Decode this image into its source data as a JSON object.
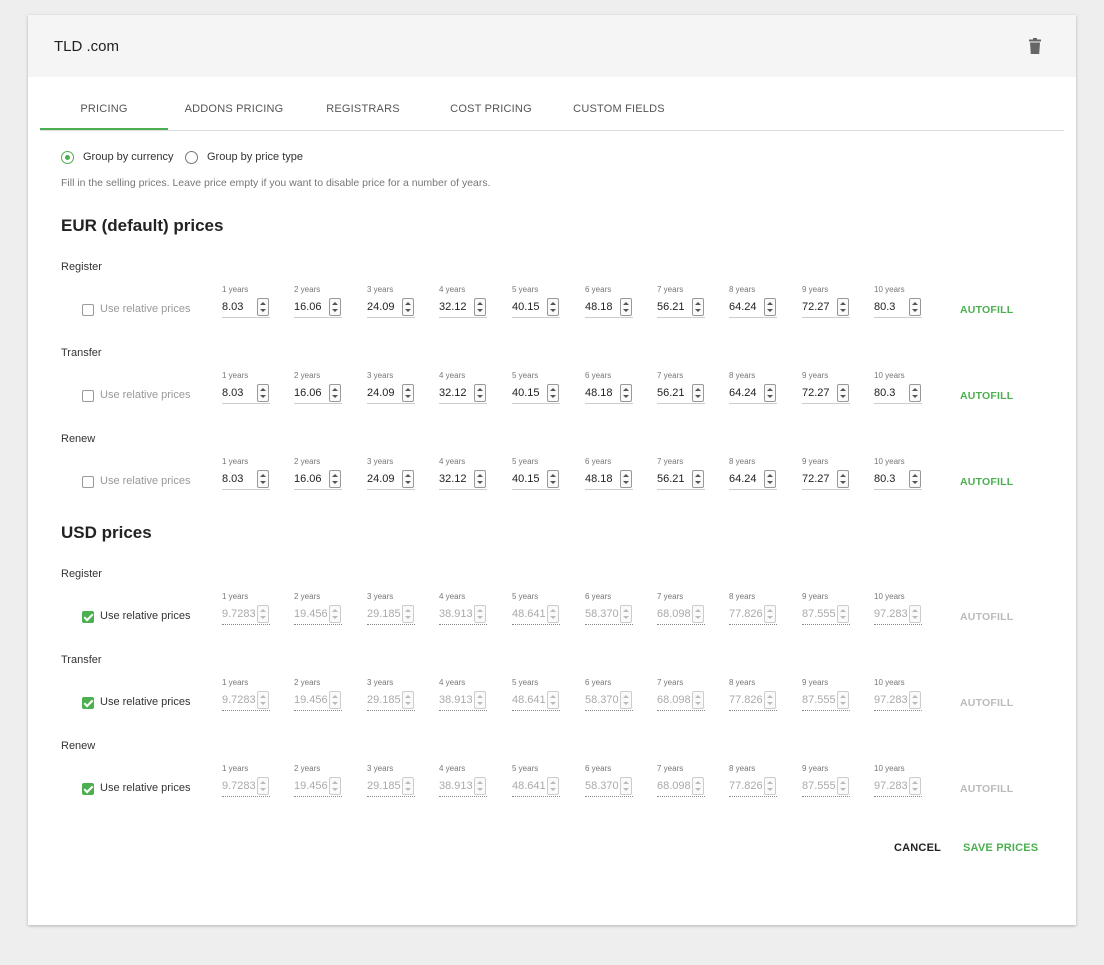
{
  "header": {
    "title": "TLD .com"
  },
  "tabs": [
    {
      "label": "PRICING",
      "active": true
    },
    {
      "label": "ADDONS PRICING"
    },
    {
      "label": "REGISTRARS"
    },
    {
      "label": "COST PRICING"
    },
    {
      "label": "CUSTOM FIELDS"
    }
  ],
  "group_by": {
    "options": [
      {
        "label": "Group by currency",
        "selected": true
      },
      {
        "label": "Group by price type",
        "selected": false
      }
    ]
  },
  "helper_text": "Fill in the selling prices. Leave price empty if you want to disable price for a number of years.",
  "relative_label": "Use relative prices",
  "autofill_label": "AUTOFILL",
  "year_labels": [
    "1 years",
    "2 years",
    "3 years",
    "4 years",
    "5 years",
    "6 years",
    "7 years",
    "8 years",
    "9 years",
    "10 years"
  ],
  "sections": [
    {
      "title": "EUR (default)  prices",
      "rows": [
        {
          "label": "Register",
          "relative": false,
          "prices": [
            "8.03",
            "16.06",
            "24.09",
            "32.12",
            "40.15",
            "48.18",
            "56.21",
            "64.24",
            "72.27",
            "80.3"
          ]
        },
        {
          "label": "Transfer",
          "relative": false,
          "prices": [
            "8.03",
            "16.06",
            "24.09",
            "32.12",
            "40.15",
            "48.18",
            "56.21",
            "64.24",
            "72.27",
            "80.3"
          ]
        },
        {
          "label": "Renew",
          "relative": false,
          "prices": [
            "8.03",
            "16.06",
            "24.09",
            "32.12",
            "40.15",
            "48.18",
            "56.21",
            "64.24",
            "72.27",
            "80.3"
          ]
        }
      ]
    },
    {
      "title": "USD  prices",
      "rows": [
        {
          "label": "Register",
          "relative": true,
          "prices": [
            "9.7283",
            "19.456",
            "29.185",
            "38.913",
            "48.641",
            "58.370",
            "68.098",
            "77.826",
            "87.555",
            "97.283"
          ]
        },
        {
          "label": "Transfer",
          "relative": true,
          "prices": [
            "9.7283",
            "19.456",
            "29.185",
            "38.913",
            "48.641",
            "58.370",
            "68.098",
            "77.826",
            "87.555",
            "97.283"
          ]
        },
        {
          "label": "Renew",
          "relative": true,
          "prices": [
            "9.7283",
            "19.456",
            "29.185",
            "38.913",
            "48.641",
            "58.370",
            "68.098",
            "77.826",
            "87.555",
            "97.283"
          ]
        }
      ]
    }
  ],
  "footer": {
    "cancel_label": "CANCEL",
    "save_label": "SAVE PRICES"
  },
  "colors": {
    "accent": "#4caf50",
    "header_bg": "#f5f5f5",
    "page_bg": "#eeeeee"
  }
}
